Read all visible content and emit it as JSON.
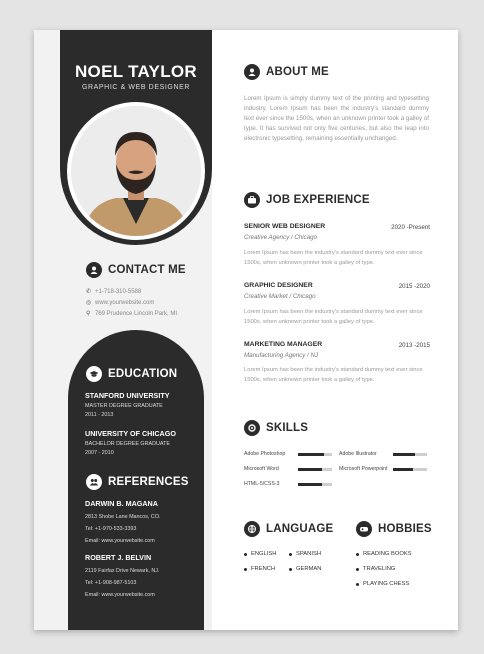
{
  "header": {
    "name": "NOEL TAYLOR",
    "role": "GRAPHIC & WEB DESIGNER"
  },
  "contact": {
    "title": "CONTACT ME",
    "items": [
      {
        "icon": "phone-icon",
        "text": "+1-718-310-5588"
      },
      {
        "icon": "globe-icon",
        "text": "www.yourwebsite.com"
      },
      {
        "icon": "location-icon",
        "text": "769 Prudence Lincoln Park, MI"
      }
    ]
  },
  "education": {
    "title": "EDUCATION",
    "items": [
      {
        "school": "STANFORD UNIVERSITY",
        "degree": "MASTER DEGREE GRADUATE",
        "years": "2011 - 2013"
      },
      {
        "school": "UNIVERSITY OF CHICAGO",
        "degree": "BACHELOR DEGREE GRADUATE",
        "years": "2007 - 2010"
      }
    ]
  },
  "references": {
    "title": "REFERENCES",
    "items": [
      {
        "name": "DARWIN B. MAGANA",
        "address": "2813 Shobe Lane Mancos, CO.",
        "tel": "Tel: +1-970-533-3393",
        "email": "Email: www.yourwebsite.com"
      },
      {
        "name": "ROBERT J. BELVIN",
        "address": "2119 Fairfax Drive Newark, NJ.",
        "tel": "Tel: +1-908-987-5103",
        "email": "Email: www.yourwebsite.com"
      }
    ]
  },
  "about": {
    "title": "ABOUT ME",
    "text": "Lorem Ipsum is simply dummy text of the printing and typesetting industry. Lorem Ipsum has been the industry's standard dummy text ever since the 1500s, when an unknown printer took a galley of type. It has survived not only five centuries, but also the leap into electronic typesetting, remaining essentially unchanged."
  },
  "experience": {
    "title": "JOB EXPERIENCE",
    "jobs": [
      {
        "title": "SENIOR WEB DESIGNER",
        "dates": "2020 -Present",
        "company": "Creative Agency / Chicago",
        "desc": "Lorem Ipsum has been the industry's standard dummy text ever since 1500s, when unknown printer took a galley of type."
      },
      {
        "title": "GRAPHIC DESIGNER",
        "dates": "2015 -2020",
        "company": "Creative Market / Chicago",
        "desc": "Lorem Ipsum has been the industry's standard dummy text ever since 1500s, when unknown printer took a galley of type."
      },
      {
        "title": "MARKETING MANAGER",
        "dates": "2013 -2015",
        "company": "Manufacturing Agency / NJ",
        "desc": "Lorem Ipsum has been the industry's standard dummy text ever since 1500s, when unknown printer took a galley of type."
      }
    ]
  },
  "skills": {
    "title": "SKILLS",
    "items": [
      {
        "label": "Adobe Photoshop",
        "level": 0.75
      },
      {
        "label": "Adobe Illustrator",
        "level": 0.65
      },
      {
        "label": "Microsoft Word",
        "level": 0.7
      },
      {
        "label": "Microsoft Powerpoint",
        "level": 0.6
      },
      {
        "label": "HTML-5/CSS-3",
        "level": 0.7
      }
    ]
  },
  "language": {
    "title": "LANGUAGE",
    "items": [
      "ENGLISH",
      "SPANISH",
      "FRENCH",
      "GERMAN"
    ]
  },
  "hobbies": {
    "title": "HOBBIES",
    "items": [
      "READING BOOKS",
      "TRAVELING",
      "PLAYING CHESS"
    ]
  },
  "colors": {
    "dark": "#2b2b2b",
    "light": "#f2f2f2",
    "text_gray": "#999999"
  }
}
